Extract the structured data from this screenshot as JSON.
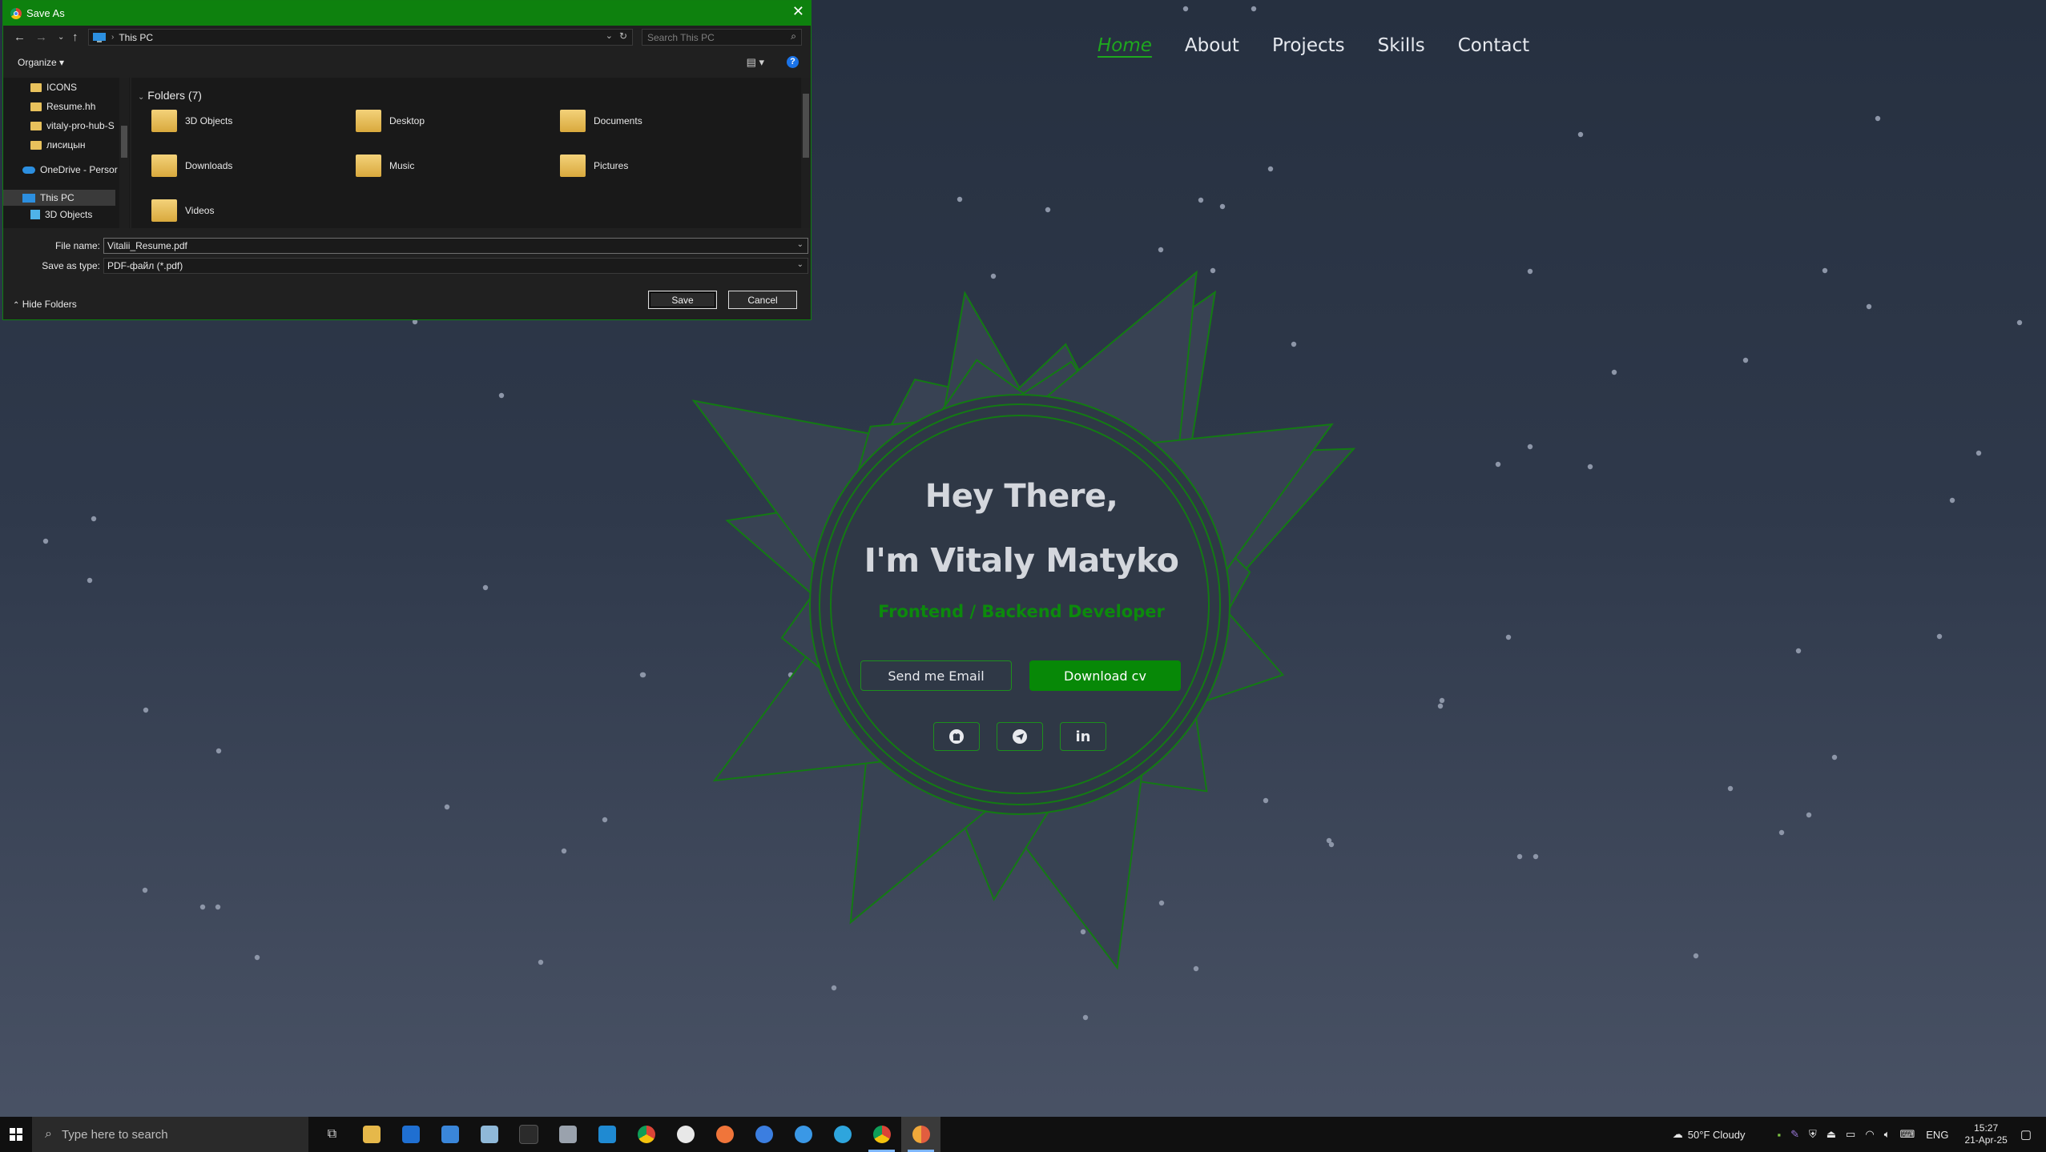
{
  "site": {
    "nav": [
      "Home",
      "About",
      "Projects",
      "Skills",
      "Contact"
    ],
    "hero": {
      "line1": "Hey There,",
      "line2": "I'm Vitaly Matyko",
      "role": "Frontend / Backend Developer",
      "email_button": "Send me Email",
      "download_button": "Download cv"
    },
    "socials": [
      "github-icon",
      "telegram-icon",
      "linkedin-icon"
    ],
    "accent_color": "#078807"
  },
  "dialog": {
    "title": "Save As",
    "path": "This PC",
    "search_placeholder": "Search This PC",
    "organize": "Organize",
    "nav_pane": [
      {
        "label": "ICONS",
        "icon": "folder-icon"
      },
      {
        "label": "Resume.hh",
        "icon": "folder-icon"
      },
      {
        "label": "vitaly-pro-hub-S",
        "icon": "folder-icon"
      },
      {
        "label": "лисицын",
        "icon": "folder-icon"
      },
      {
        "label": "OneDrive - Persor",
        "icon": "onedrive-icon"
      },
      {
        "label": "This PC",
        "icon": "pc-icon"
      },
      {
        "label": "3D Objects",
        "icon": "3d-objects-icon"
      }
    ],
    "group_header": "Folders (7)",
    "folders": [
      "3D Objects",
      "Desktop",
      "Documents",
      "Downloads",
      "Music",
      "Pictures",
      "Videos"
    ],
    "file_name_label": "File name:",
    "file_name_value": "Vitalii_Resume.pdf",
    "save_type_label": "Save as type:",
    "save_type_value": "PDF-файл (*.pdf)",
    "hide_folders": "Hide Folders",
    "save_button": "Save",
    "cancel_button": "Cancel"
  },
  "taskbar": {
    "search_placeholder": "Type here to search",
    "weather": "50°F  Cloudy",
    "language": "ENG",
    "time": "15:27",
    "date": "21-Apr-25"
  }
}
